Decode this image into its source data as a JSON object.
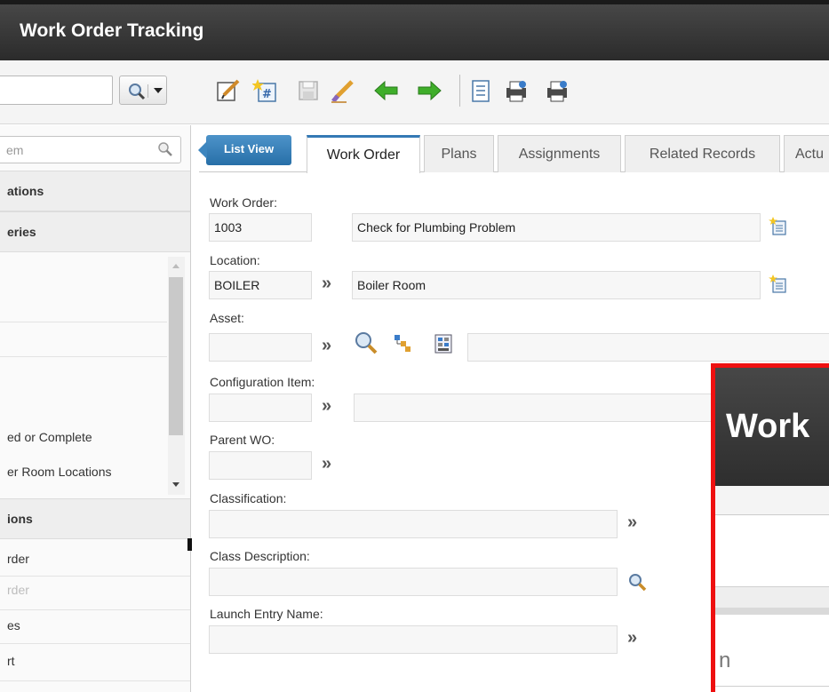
{
  "app": {
    "title": "Work Order Tracking"
  },
  "nav": {
    "search_placeholder": "em",
    "sections": [
      {
        "label": "ations"
      },
      {
        "label": "eries"
      },
      {
        "label": "ions"
      }
    ],
    "query_items": [
      "ed or Complete",
      "er Room Locations"
    ],
    "action_items": [
      {
        "label": "rder",
        "dim": false
      },
      {
        "label": "rder",
        "dim": true
      },
      {
        "label": "es",
        "dim": false
      },
      {
        "label": "rt",
        "dim": false
      }
    ]
  },
  "tabs": {
    "list_view": "List View",
    "items": [
      "Work Order",
      "Plans",
      "Assignments",
      "Related Records",
      "Actu"
    ],
    "active": "Work Order"
  },
  "form": {
    "work_order_label": "Work Order:",
    "work_order_value": "1003",
    "work_order_desc": "Check for Plumbing Problem",
    "location_label": "Location:",
    "location_value": "BOILER",
    "location_desc": "Boiler Room",
    "asset_label": "Asset:",
    "config_item_label": "Configuration Item:",
    "parent_wo_label": "Parent WO:",
    "classification_label": "Classification:",
    "class_desc_label": "Class Description:",
    "launch_entry_label": "Launch Entry Name:",
    "chevron": "»"
  },
  "inset": {
    "title": "Work",
    "partial_letter": "n",
    "border_color": "#ee1010"
  },
  "colors": {
    "titlebar": "#2b2b2b",
    "accent": "#3479b5",
    "list_view": "#276fa8"
  }
}
